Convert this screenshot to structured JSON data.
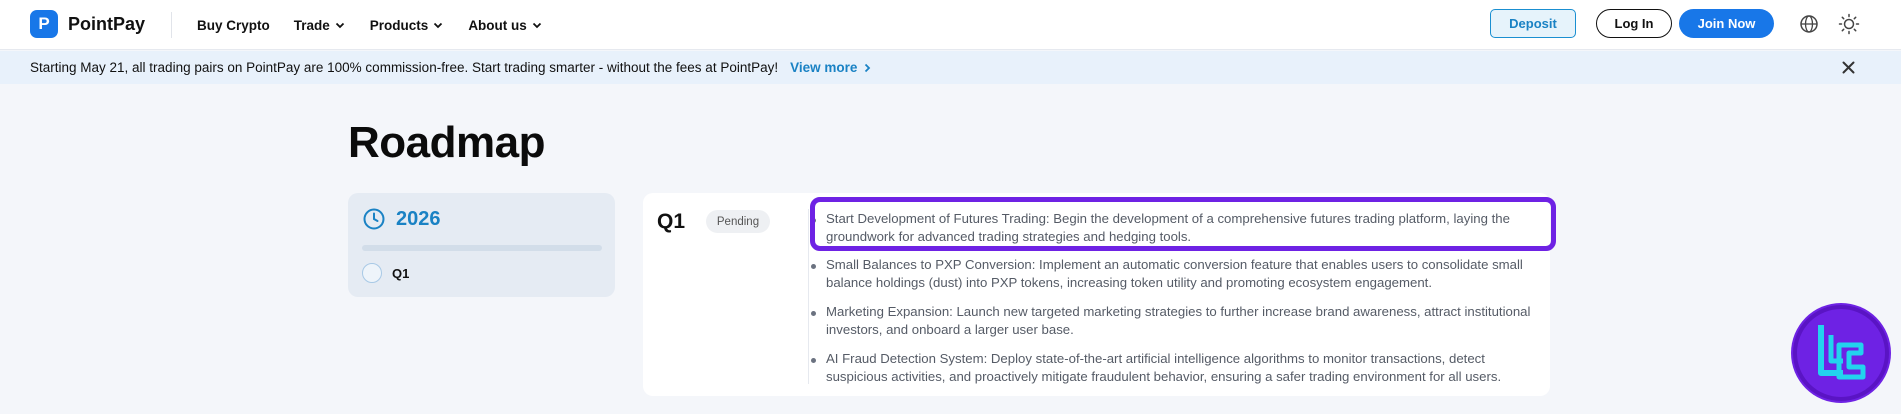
{
  "header": {
    "logo_mark": "P",
    "logo_text": "PointPay",
    "nav": [
      {
        "label": "Buy Crypto",
        "has_dropdown": false
      },
      {
        "label": "Trade",
        "has_dropdown": true
      },
      {
        "label": "Products",
        "has_dropdown": true
      },
      {
        "label": "About us",
        "has_dropdown": true
      }
    ],
    "deposit_label": "Deposit",
    "login_label": "Log In",
    "join_label": "Join Now",
    "icons": [
      "globe-icon",
      "sun-icon"
    ]
  },
  "banner": {
    "text": "Starting May 21, all trading pairs on PointPay are 100% commission-free. Start trading smarter - without the fees at PointPay!",
    "link_label": "View more"
  },
  "page_title": "Roadmap",
  "year_card": {
    "year": "2026",
    "quarters": [
      "Q1"
    ]
  },
  "detail": {
    "quarter": "Q1",
    "status": "Pending",
    "tasks": [
      "Start Development of Futures Trading: Begin the development of a comprehensive futures trading platform, laying the groundwork for advanced trading strategies and hedging tools.",
      "Small Balances to PXP Conversion: Implement an automatic conversion feature that enables users to consolidate small balance holdings (dust) into PXP tokens, increasing token utility and promoting ecosystem engagement.",
      "Marketing Expansion: Launch new targeted marketing strategies to further increase brand awareness, attract institutional investors, and onboard a larger user base.",
      "AI Fraud Detection System: Deploy state-of-the-art artificial intelligence algorithms to monitor transactions, detect suspicious activities, and proactively mitigate fraudulent behavior, ensuring a safer trading environment for all users."
    ],
    "highlighted_task_index": 0
  },
  "colors": {
    "brand": "#1877e8",
    "accent": "#1a82c4",
    "highlight": "#6e22e4",
    "banner_bg": "#e8f1fb"
  }
}
